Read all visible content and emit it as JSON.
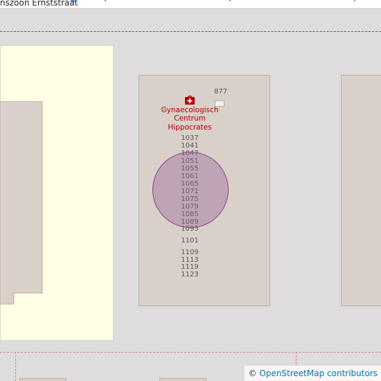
{
  "map": {
    "street": {
      "name": "nszoon Ernststraat",
      "oneway_arrow": "→"
    },
    "poi": {
      "name": "Gynaecologisch Centrum Hippocrates",
      "icon": "hospital-icon",
      "color": "#b40000"
    },
    "marker_circle_color": "#996699",
    "house_numbers": {
      "n877": "877",
      "n1037": "1037",
      "n1041": "1041",
      "n1047": "1047",
      "n1051": "1051",
      "n1055": "1055",
      "n1061": "1061",
      "n1065": "1065",
      "n1071": "1071",
      "n1075": "1075",
      "n1079": "1079",
      "n1085": "1085",
      "n1089": "1089",
      "n1093": "1093",
      "n1101": "1101",
      "n1109": "1109",
      "n1113": "1113",
      "n1119": "1119",
      "n1123": "1123"
    },
    "attribution": {
      "copyright": "©",
      "link": "OpenStreetMap contributors"
    }
  }
}
